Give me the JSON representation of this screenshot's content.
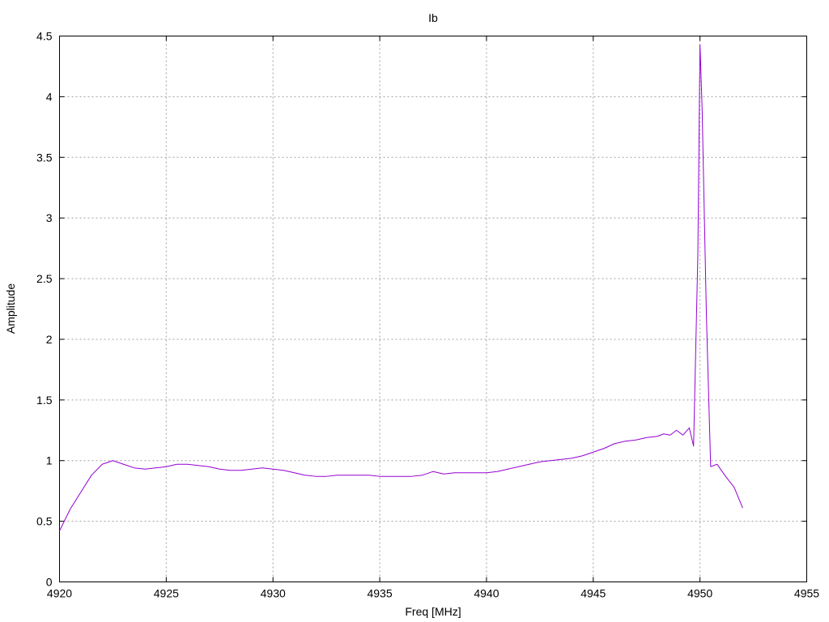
{
  "chart_data": {
    "type": "line",
    "title": "Ib",
    "xlabel": "Freq [MHz]",
    "ylabel": "Amplitude",
    "xlim": [
      4920,
      4955
    ],
    "ylim": [
      0,
      4.5
    ],
    "grid": true,
    "x_ticks": [
      4920,
      4925,
      4930,
      4935,
      4940,
      4945,
      4950,
      4955
    ],
    "y_ticks": [
      0,
      0.5,
      1,
      1.5,
      2,
      2.5,
      3,
      3.5,
      4,
      4.5
    ],
    "x_tick_labels": [
      "4920",
      "4925",
      "4930",
      "4935",
      "4940",
      "4945",
      "4950",
      "4955"
    ],
    "y_tick_labels": [
      "0",
      "0.5",
      "1",
      "1.5",
      "2",
      "2.5",
      "3",
      "3.5",
      "4",
      "4.5"
    ],
    "series": [
      {
        "color": "#9400d3",
        "x": [
          4920,
          4920.5,
          4921,
          4921.5,
          4922,
          4922.5,
          4923,
          4923.5,
          4924,
          4924.5,
          4925,
          4925.5,
          4926,
          4926.5,
          4927,
          4927.5,
          4928,
          4928.5,
          4929,
          4929.5,
          4930,
          4930.5,
          4931,
          4931.5,
          4932,
          4932.5,
          4933,
          4933.5,
          4934,
          4934.5,
          4935,
          4935.5,
          4936,
          4936.5,
          4937,
          4937.5,
          4938,
          4938.5,
          4939,
          4939.5,
          4940,
          4940.5,
          4941,
          4941.5,
          4942,
          4942.5,
          4943,
          4943.5,
          4944,
          4944.5,
          4945,
          4945.5,
          4946,
          4946.5,
          4947,
          4947.5,
          4948,
          4948.3,
          4948.6,
          4948.9,
          4949.2,
          4949.5,
          4949.7,
          4949.9,
          4950,
          4950.1,
          4950.3,
          4950.5,
          4950.8,
          4951.2,
          4951.6,
          4952
        ],
        "y": [
          0.42,
          0.6,
          0.74,
          0.88,
          0.97,
          1.0,
          0.97,
          0.94,
          0.93,
          0.94,
          0.95,
          0.97,
          0.97,
          0.96,
          0.95,
          0.93,
          0.92,
          0.92,
          0.93,
          0.94,
          0.93,
          0.92,
          0.9,
          0.88,
          0.87,
          0.87,
          0.88,
          0.88,
          0.88,
          0.88,
          0.87,
          0.87,
          0.87,
          0.87,
          0.88,
          0.91,
          0.89,
          0.9,
          0.9,
          0.9,
          0.9,
          0.91,
          0.93,
          0.95,
          0.97,
          0.99,
          1.0,
          1.01,
          1.02,
          1.04,
          1.07,
          1.1,
          1.14,
          1.16,
          1.17,
          1.19,
          1.2,
          1.22,
          1.21,
          1.25,
          1.21,
          1.27,
          1.12,
          2.7,
          4.43,
          3.9,
          2.2,
          0.95,
          0.97,
          0.87,
          0.78,
          0.61
        ]
      }
    ]
  }
}
